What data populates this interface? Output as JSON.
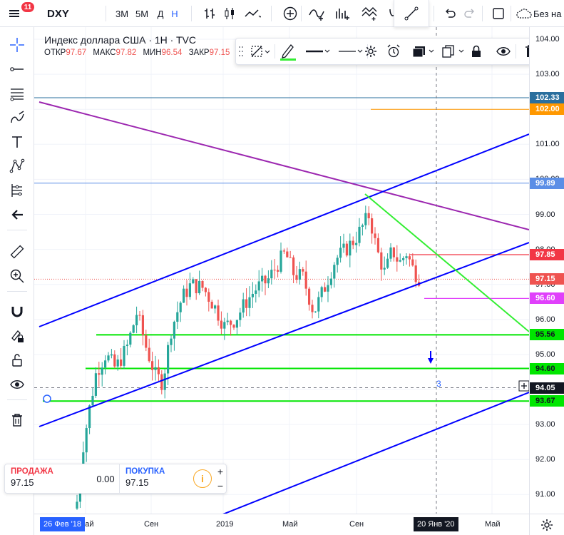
{
  "toolbar": {
    "badge": "11",
    "symbol": "DXY",
    "intervals": [
      "3M",
      "5M",
      "Д",
      "Н"
    ],
    "active_interval": "Н",
    "no_chart_label": "Без на"
  },
  "legend": {
    "title": "Индекс доллара США · 1H · TVC",
    "open_label": "ОТКР",
    "open": "97.67",
    "high_label": "МАКС",
    "high": "97.82",
    "low_label": "МИН",
    "low": "96.54",
    "close_label": "ЗАКР",
    "close": "97.15"
  },
  "price_axis": {
    "ticks": [
      "104.00",
      "103.00",
      "102.00",
      "101.00",
      "100.00",
      "99.00",
      "98.00",
      "97.00",
      "96.00",
      "95.00",
      "94.00",
      "93.00",
      "92.00",
      "91.00"
    ],
    "labels": [
      {
        "text": "102.33",
        "color": "#2a6f9e"
      },
      {
        "text": "102.00",
        "color": "#ff9800"
      },
      {
        "text": "99.89",
        "color": "#5b8ee6"
      },
      {
        "text": "97.85",
        "color": "#f23645"
      },
      {
        "text": "97.15",
        "color": "#ef5350"
      },
      {
        "text": "96.60",
        "color": "#e040fb"
      },
      {
        "text": "95.56",
        "color": "#00e600"
      },
      {
        "text": "94.60",
        "color": "#00e600"
      },
      {
        "text": "94.05",
        "color": "#131722"
      },
      {
        "text": "93.67",
        "color": "#00e600"
      }
    ]
  },
  "time_axis": {
    "ticks": [
      "Май",
      "Сен",
      "2019",
      "Май",
      "Сен",
      "Май"
    ],
    "start_label": "26 Фев '18",
    "cursor_label": "20 Янв '20"
  },
  "annotation": "3",
  "trade": {
    "sell_label": "ПРОДАЖА",
    "sell_price": "97.15",
    "spread": "0.00",
    "buy_label": "ПОКУПКА",
    "buy_price": "97.15",
    "order_icon": "i",
    "plus": "+",
    "minus": "−"
  },
  "colors": {
    "up": "#26a69a",
    "down": "#ef5350",
    "channel": "#0000ff",
    "resistance": "#9c27b0",
    "support": "#00e600",
    "trendline": "#33ee33",
    "accent": "#2962ff"
  },
  "icons": {
    "left": [
      "crosshair-icon",
      "trendline-icon",
      "fib-icon",
      "brush-icon",
      "text-icon",
      "pattern-icon",
      "prediction-icon",
      "back-icon",
      "ruler-icon",
      "zoom-icon",
      "magnet-icon",
      "lock-draw-icon",
      "unlock-icon",
      "eye-icon",
      "trash-icon"
    ]
  }
}
